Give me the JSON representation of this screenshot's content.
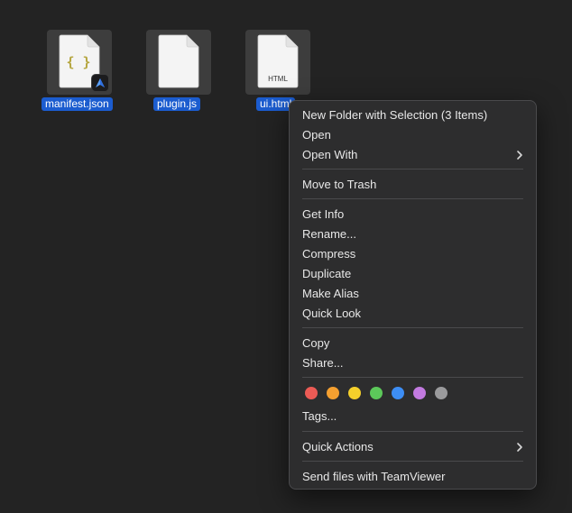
{
  "files": [
    {
      "name": "manifest.json",
      "type": "json",
      "selected": true,
      "badge_icon": "figma-arrow-badge-icon",
      "glyph": "{ }"
    },
    {
      "name": "plugin.js",
      "type": "js",
      "selected": true
    },
    {
      "name": "ui.html",
      "type": "html",
      "selected": true,
      "glyph": "HTML"
    }
  ],
  "context_menu": {
    "items": {
      "new_folder": "New Folder with Selection (3 Items)",
      "open": "Open",
      "open_with": "Open With",
      "move_to_trash": "Move to Trash",
      "get_info": "Get Info",
      "rename": "Rename...",
      "compress": "Compress",
      "duplicate": "Duplicate",
      "make_alias": "Make Alias",
      "quick_look": "Quick Look",
      "copy": "Copy",
      "share": "Share...",
      "tags": "Tags...",
      "quick_actions": "Quick Actions",
      "send_teamviewer": "Send files with TeamViewer"
    },
    "submenu_icon": "chevron-right-icon",
    "tag_colors": [
      {
        "name": "Red",
        "color": "#ec5b55"
      },
      {
        "name": "Orange",
        "color": "#f5a030"
      },
      {
        "name": "Yellow",
        "color": "#f5d02b"
      },
      {
        "name": "Green",
        "color": "#5cc85a"
      },
      {
        "name": "Blue",
        "color": "#3d8ef5"
      },
      {
        "name": "Purple",
        "color": "#c27ae0"
      },
      {
        "name": "Gray",
        "color": "#9a9a9c"
      }
    ]
  },
  "colors": {
    "desktop_background": "#232323",
    "selection_label": "#1b5ccf",
    "menu_background": "#2d2d2e",
    "menu_text": "#e8e8e8",
    "json_glyph": "#b5a640"
  }
}
